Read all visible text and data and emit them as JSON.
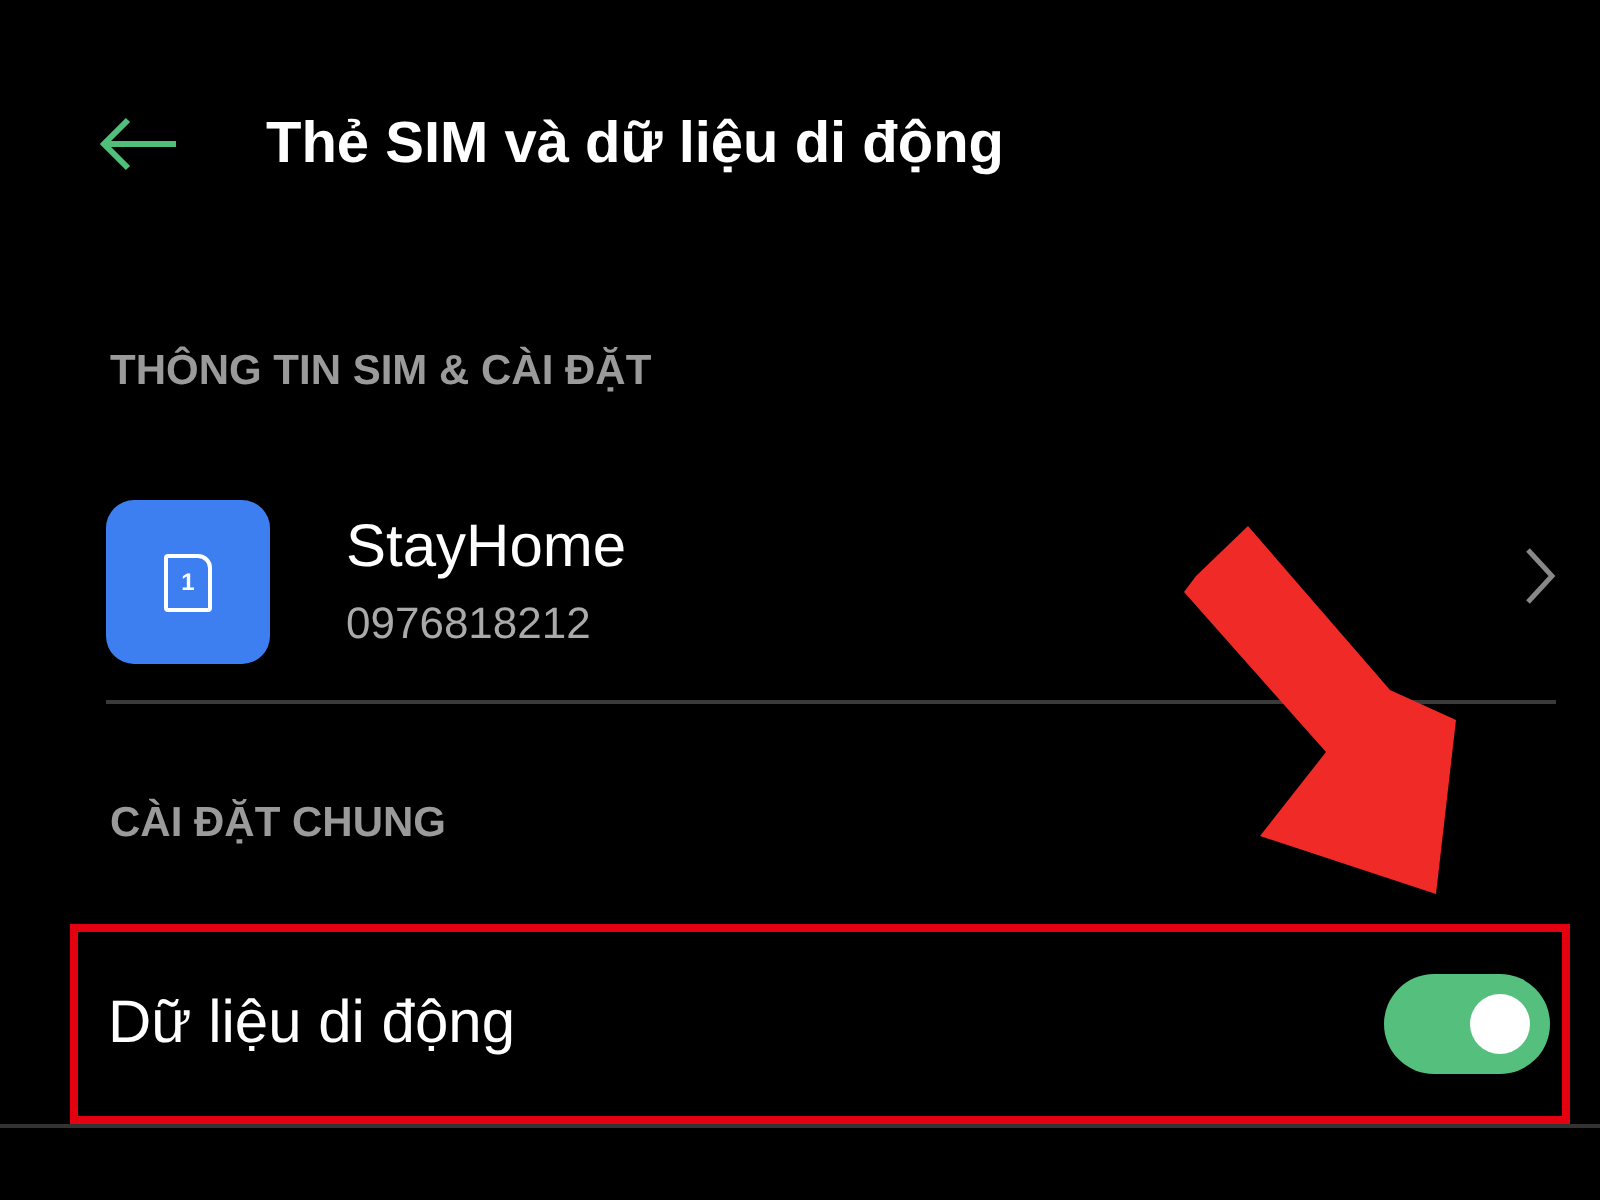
{
  "header": {
    "title": "Thẻ SIM và dữ liệu di động"
  },
  "sections": [
    {
      "title": "THÔNG TIN SIM & CÀI ĐẶT",
      "items": [
        {
          "kind": "sim",
          "slot": "1",
          "name": "StayHome",
          "number": "0976818212"
        }
      ]
    },
    {
      "title": "CÀI ĐẶT CHUNG",
      "items": [
        {
          "kind": "toggle",
          "label": "Dữ liệu di động",
          "on": true,
          "highlighted": true
        }
      ]
    }
  ]
}
